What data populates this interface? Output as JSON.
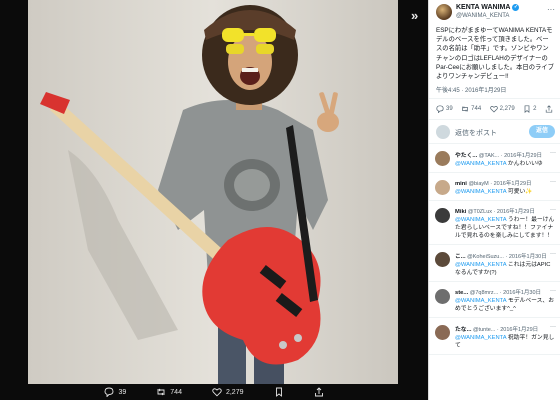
{
  "viewer": {
    "actions": {
      "replies": "39",
      "retweets": "744",
      "likes": "2,279"
    },
    "expand_icon": "double-chevron-right-icon"
  },
  "tweet": {
    "display_name": "KENTA WANIMA",
    "handle": "@WANIMA_KENTA",
    "body": "ESPにわがままゆーてWANIMA KENTAモデルのベースを作って頂きました。ベースの名前は「助平」です。ゾンビやワンチャンのロゴはLEFLAHのデザイナーのPar-Ceeにお願いしました。本日のライブよりワンチャンデビュー!!",
    "timestamp": "午後4:45 · 2016年1月29日",
    "stats": {
      "replies": "39",
      "retweets": "744",
      "likes": "2,279",
      "bookmarks": "2"
    },
    "reply_placeholder": "返信をポスト",
    "reply_button": "返信"
  },
  "replies": [
    {
      "name": "やたく...",
      "handle": "@TAK...",
      "date": "· 2016年1月29日",
      "mention": "@WANIMA_KENTA",
      "text": "かんわいいゆ",
      "avatar_color": "#9a7b5c"
    },
    {
      "name": "mini",
      "handle": "@biayM",
      "date": "· 2016年1月29日",
      "mention": "@WANIMA_KENTA",
      "text": "可愛い✨",
      "avatar_color": "#c7a98a"
    },
    {
      "name": "Miki",
      "handle": "@T0ZLux",
      "date": "· 2016年1月29日",
      "mention": "@WANIMA_KENTA",
      "text": "うわー！最ーけんた君らしいベースですね！！ファイナルで見れるのを楽しみにしてます！！",
      "avatar_color": "#3b3b3b"
    },
    {
      "name": "こ...",
      "handle": "@KoheiSuzu...",
      "date": "· 2016年1月30日",
      "mention": "@WANIMA_KENTA",
      "text": "これは元はAPICなるんですか(?)",
      "avatar_color": "#5c4a3a"
    },
    {
      "name": "ste...",
      "handle": "@7q8mrz...",
      "date": "· 2016年1月30日",
      "mention": "@WANIMA_KENTA",
      "text": "モデルベース、おめでとうございます^_^",
      "avatar_color": "#6e6e6e"
    },
    {
      "name": "たな...",
      "handle": "@tunte...",
      "date": "· 2016年1月29日",
      "mention": "@WANIMA_KENTA",
      "text": "祝助平！ガン見して",
      "avatar_color": "#8a6a55"
    }
  ]
}
